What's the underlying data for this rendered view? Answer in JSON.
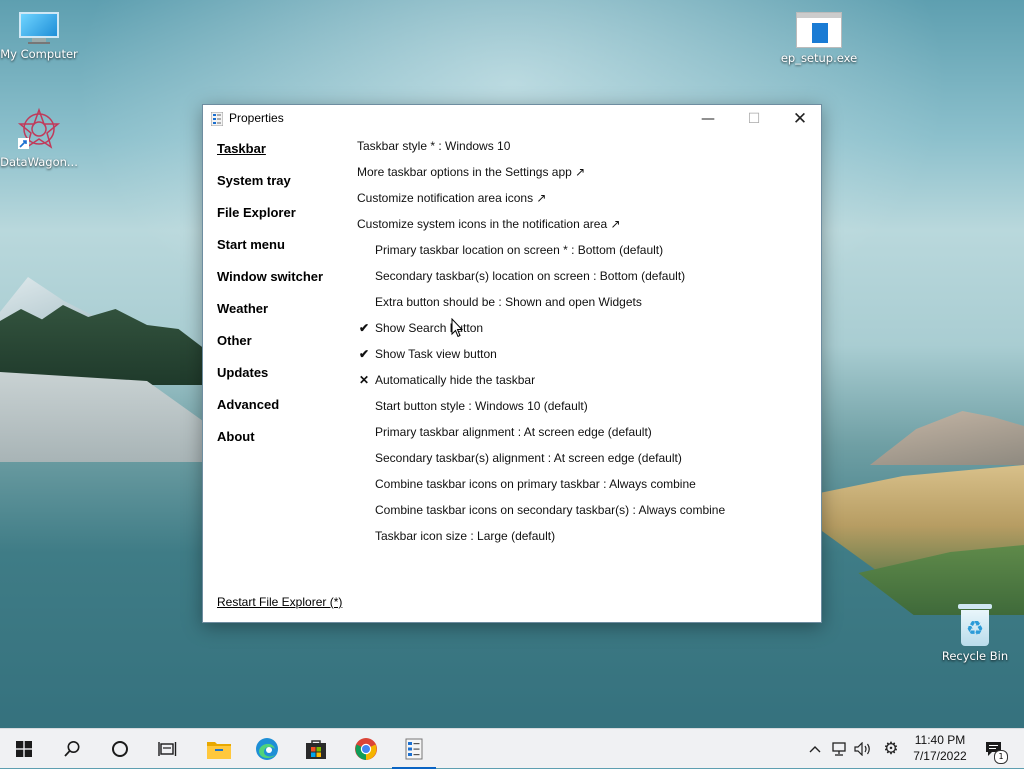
{
  "desktop": {
    "icons": [
      {
        "label": "My Computer",
        "icon": "monitor-icon"
      },
      {
        "label": "DataWagon...",
        "icon": "datawagon-icon"
      },
      {
        "label": "ep_setup.exe",
        "icon": "exe-icon"
      },
      {
        "label": "Recycle Bin",
        "icon": "recycle-bin-icon"
      }
    ]
  },
  "window": {
    "title": "Properties",
    "controls": {
      "minimize": "—",
      "maximize": "☐",
      "close": "✕"
    },
    "nav": [
      {
        "label": "Taskbar",
        "active": true
      },
      {
        "label": "System tray"
      },
      {
        "label": "File Explorer"
      },
      {
        "label": "Start menu"
      },
      {
        "label": "Window switcher"
      },
      {
        "label": "Weather"
      },
      {
        "label": "Other"
      },
      {
        "label": "Updates"
      },
      {
        "label": "Advanced"
      },
      {
        "label": "About"
      }
    ],
    "restart_link": "Restart File Explorer (*)",
    "options": [
      {
        "text": "Taskbar style * : Windows 10",
        "indent": false,
        "mark": ""
      },
      {
        "text": "More taskbar options in the Settings app ↗",
        "indent": false,
        "mark": ""
      },
      {
        "text": "Customize notification area icons ↗",
        "indent": false,
        "mark": ""
      },
      {
        "text": "Customize system icons in the notification area ↗",
        "indent": false,
        "mark": ""
      },
      {
        "text": "Primary taskbar location on screen * : Bottom (default)",
        "indent": true,
        "mark": ""
      },
      {
        "text": "Secondary taskbar(s) location on screen : Bottom (default)",
        "indent": true,
        "mark": ""
      },
      {
        "text": "Extra button should be : Shown and open Widgets",
        "indent": true,
        "mark": ""
      },
      {
        "text": "Show Search button",
        "indent": true,
        "mark": "✔"
      },
      {
        "text": "Show Task view button",
        "indent": true,
        "mark": "✔"
      },
      {
        "text": "Automatically hide the taskbar",
        "indent": true,
        "mark": "✕"
      },
      {
        "text": "Start button style : Windows 10 (default)",
        "indent": true,
        "mark": ""
      },
      {
        "text": "Primary taskbar alignment : At screen edge (default)",
        "indent": true,
        "mark": ""
      },
      {
        "text": "Secondary taskbar(s) alignment : At screen edge (default)",
        "indent": true,
        "mark": ""
      },
      {
        "text": "Combine taskbar icons on primary taskbar : Always combine",
        "indent": true,
        "mark": ""
      },
      {
        "text": "Combine taskbar icons on secondary taskbar(s) : Always combine",
        "indent": true,
        "mark": ""
      },
      {
        "text": "Taskbar icon size : Large (default)",
        "indent": true,
        "mark": ""
      }
    ]
  },
  "taskbar": {
    "buttons": [
      "windows-start-icon",
      "search-icon",
      "cortana-icon",
      "task-view-icon",
      "file-explorer-icon",
      "edge-icon",
      "store-icon",
      "chrome-icon",
      "properties-app-icon"
    ],
    "tray_icons": [
      "chevron-up-icon",
      "network-icon",
      "volume-icon",
      "settings-gear-icon",
      "notifications-icon"
    ],
    "clock": {
      "time": "11:40 PM",
      "date": "7/17/2022"
    },
    "notification_count": "1"
  },
  "colors": {
    "accent": "#0a64c4",
    "window_border": "#6e8da0"
  }
}
